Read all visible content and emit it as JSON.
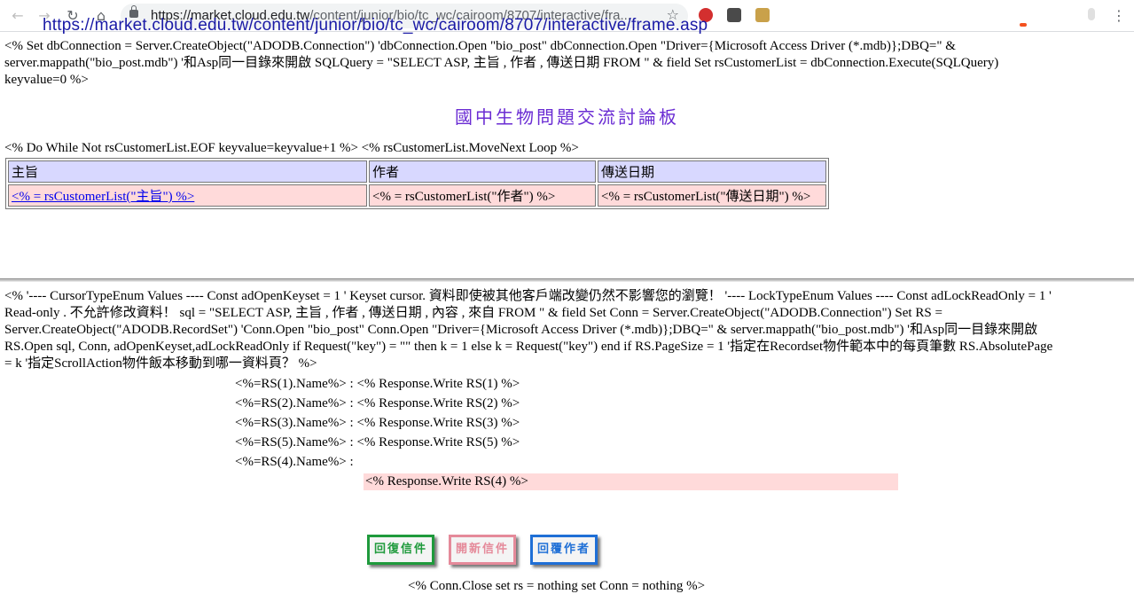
{
  "browser": {
    "url_host": "https://market.cloud.edu.tw",
    "url_path": "/content/junior/bio/tc_wc/cairoom/8707/interactive/fra...",
    "overlay_url": "https://market.cloud.edu.tw/content/junior/bio/tc_wc/cairoom/8707/interactive/frame.asp",
    "icons": [
      "back-icon",
      "forward-icon",
      "reload-icon",
      "home-icon",
      "lock-icon",
      "star-icon"
    ]
  },
  "top_frame": {
    "asp_code_lines": [
      "<% Set dbConnection = Server.CreateObject(\"ADODB.Connection\") 'dbConnection.Open \"bio_post\" dbConnection.Open \"Driver={Microsoft Access Driver (*.mdb)};DBQ=\" &",
      "server.mappath(\"bio_post.mdb\") '和Asp同一目錄來開啟 SQLQuery = \"SELECT ASP, 主旨 , 作者 , 傳送日期 FROM \" & field Set rsCustomerList = dbConnection.Execute(SQLQuery)",
      "keyvalue=0 %>"
    ],
    "title": "國中生物問題交流討論板",
    "loop_code": "<% Do While Not rsCustomerList.EOF keyvalue=keyvalue+1 %> <% rsCustomerList.MoveNext Loop %>",
    "table": {
      "headers": [
        "主旨",
        "作者",
        "傳送日期"
      ],
      "row": [
        "<% = rsCustomerList(\"主旨\") %>",
        "<% = rsCustomerList(\"作者\") %>",
        "<% = rsCustomerList(\"傳送日期\") %>"
      ]
    }
  },
  "bottom_frame": {
    "asp_code_lines": [
      "<% '---- CursorTypeEnum Values ---- Const adOpenKeyset = 1 ' Keyset cursor. 資料即使被其他客戶端改變仍然不影響您的瀏覽！ '---- LockTypeEnum Values ---- Const adLockReadOnly = 1 '",
      "Read-only . 不允許修改資料！ sql = \"SELECT ASP, 主旨 , 作者 , 傳送日期 , 內容 , 來自 FROM \" & field Set Conn = Server.CreateObject(\"ADODB.Connection\") Set RS =",
      "Server.CreateObject(\"ADODB.RecordSet\") 'Conn.Open \"bio_post\" Conn.Open \"Driver={Microsoft Access Driver (*.mdb)};DBQ=\" & server.mappath(\"bio_post.mdb\") '和Asp同一目錄來開啟",
      "RS.Open sql, Conn, adOpenKeyset,adLockReadOnly if Request(\"key\") = \"\" then k = 1 else k = Request(\"key\") end if RS.PageSize = 1 '指定在Recordset物件範本中的每頁筆數 RS.AbsolutePage",
      "= k '指定ScrollAction物件飯本移動到哪一資料頁？ %>"
    ],
    "fields": [
      "<%=RS(1).Name%> : <% Response.Write RS(1) %>",
      "<%=RS(2).Name%> : <% Response.Write RS(2) %>",
      "<%=RS(3).Name%> : <% Response.Write RS(3) %>",
      "<%=RS(5).Name%> : <% Response.Write RS(5) %>",
      "<%=RS(4).Name%> :"
    ],
    "content_value": "<% Response.Write RS(4) %>",
    "buttons": {
      "reply": "回復信件",
      "new": "開新信件",
      "reply_author": "回覆作者"
    },
    "close_code": "<% Conn.Close set rs = nothing set Conn = nothing %>"
  },
  "colors": {
    "title": "#6a2cd3",
    "header_bg": "#d8d8ff",
    "row_bg": "#ffdada",
    "btn_reply": "#1f9a3c",
    "btn_new": "#e58a9a",
    "btn_reply_author": "#1f6fd6"
  }
}
